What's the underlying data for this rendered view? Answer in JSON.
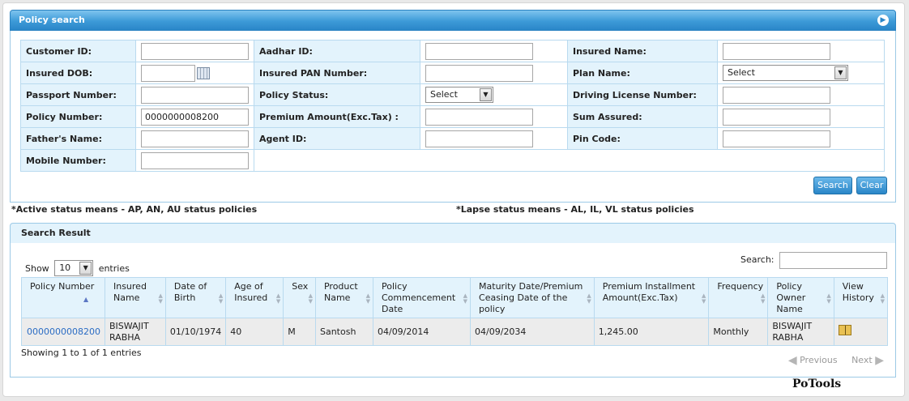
{
  "search_panel": {
    "title": "Policy search",
    "rows": [
      [
        {
          "label": "Customer ID:",
          "type": "input",
          "value": ""
        },
        {
          "label": "Aadhar ID:",
          "type": "input",
          "value": ""
        },
        {
          "label": "Insured Name:",
          "type": "input",
          "value": ""
        }
      ],
      [
        {
          "label": "Insured DOB:",
          "type": "date",
          "value": ""
        },
        {
          "label": "Insured PAN Number:",
          "type": "input",
          "value": ""
        },
        {
          "label": "Plan Name:",
          "type": "select",
          "value": "Select"
        }
      ],
      [
        {
          "label": "Passport Number:",
          "type": "input",
          "value": ""
        },
        {
          "label": "Policy Status:",
          "type": "select-small",
          "value": "Select"
        },
        {
          "label": "Driving License Number:",
          "type": "input",
          "value": ""
        }
      ],
      [
        {
          "label": "Policy Number:",
          "type": "input",
          "value": "0000000008200"
        },
        {
          "label": "Premium Amount(Exc.Tax) :",
          "type": "input",
          "value": ""
        },
        {
          "label": "Sum Assured:",
          "type": "input",
          "value": ""
        }
      ],
      [
        {
          "label": "Father's Name:",
          "type": "input",
          "value": ""
        },
        {
          "label": "Agent ID:",
          "type": "input",
          "value": ""
        },
        {
          "label": "Pin Code:",
          "type": "input",
          "value": ""
        }
      ],
      [
        {
          "label": "Mobile Number:",
          "type": "input",
          "value": ""
        }
      ]
    ],
    "search_button": "Search",
    "clear_button": "Clear"
  },
  "notes": {
    "active": "*Active status means - AP, AN, AU status policies",
    "lapse": "*Lapse status means - AL, IL, VL status policies"
  },
  "results": {
    "title": "Search Result",
    "show_label": "Show",
    "show_value": "10",
    "entries_label": "entries",
    "search_label": "Search:",
    "search_value": "",
    "columns": [
      "Policy Number",
      "Insured Name",
      "Date of Birth",
      "Age of Insured",
      "Sex",
      "Product Name",
      "Policy Commencement Date",
      "Maturity Date/Premium Ceasing Date of the policy",
      "Premium Installment Amount(Exc.Tax)",
      "Frequency",
      "Policy Owner Name",
      "View History"
    ],
    "rows": [
      {
        "policy_number": "0000000008200",
        "insured_name": "BISWAJIT RABHA",
        "dob": "01/10/1974",
        "age": "40",
        "sex": "M",
        "product": "Santosh",
        "commencement": "04/09/2014",
        "maturity": "04/09/2034",
        "premium": "1,245.00",
        "frequency": "Monthly",
        "owner": "BISWAJIT RABHA",
        "history_icon": "book-icon"
      }
    ],
    "info": "Showing 1 to 1 of 1 entries",
    "previous": "Previous",
    "next": "Next"
  },
  "watermark": "PoTools"
}
